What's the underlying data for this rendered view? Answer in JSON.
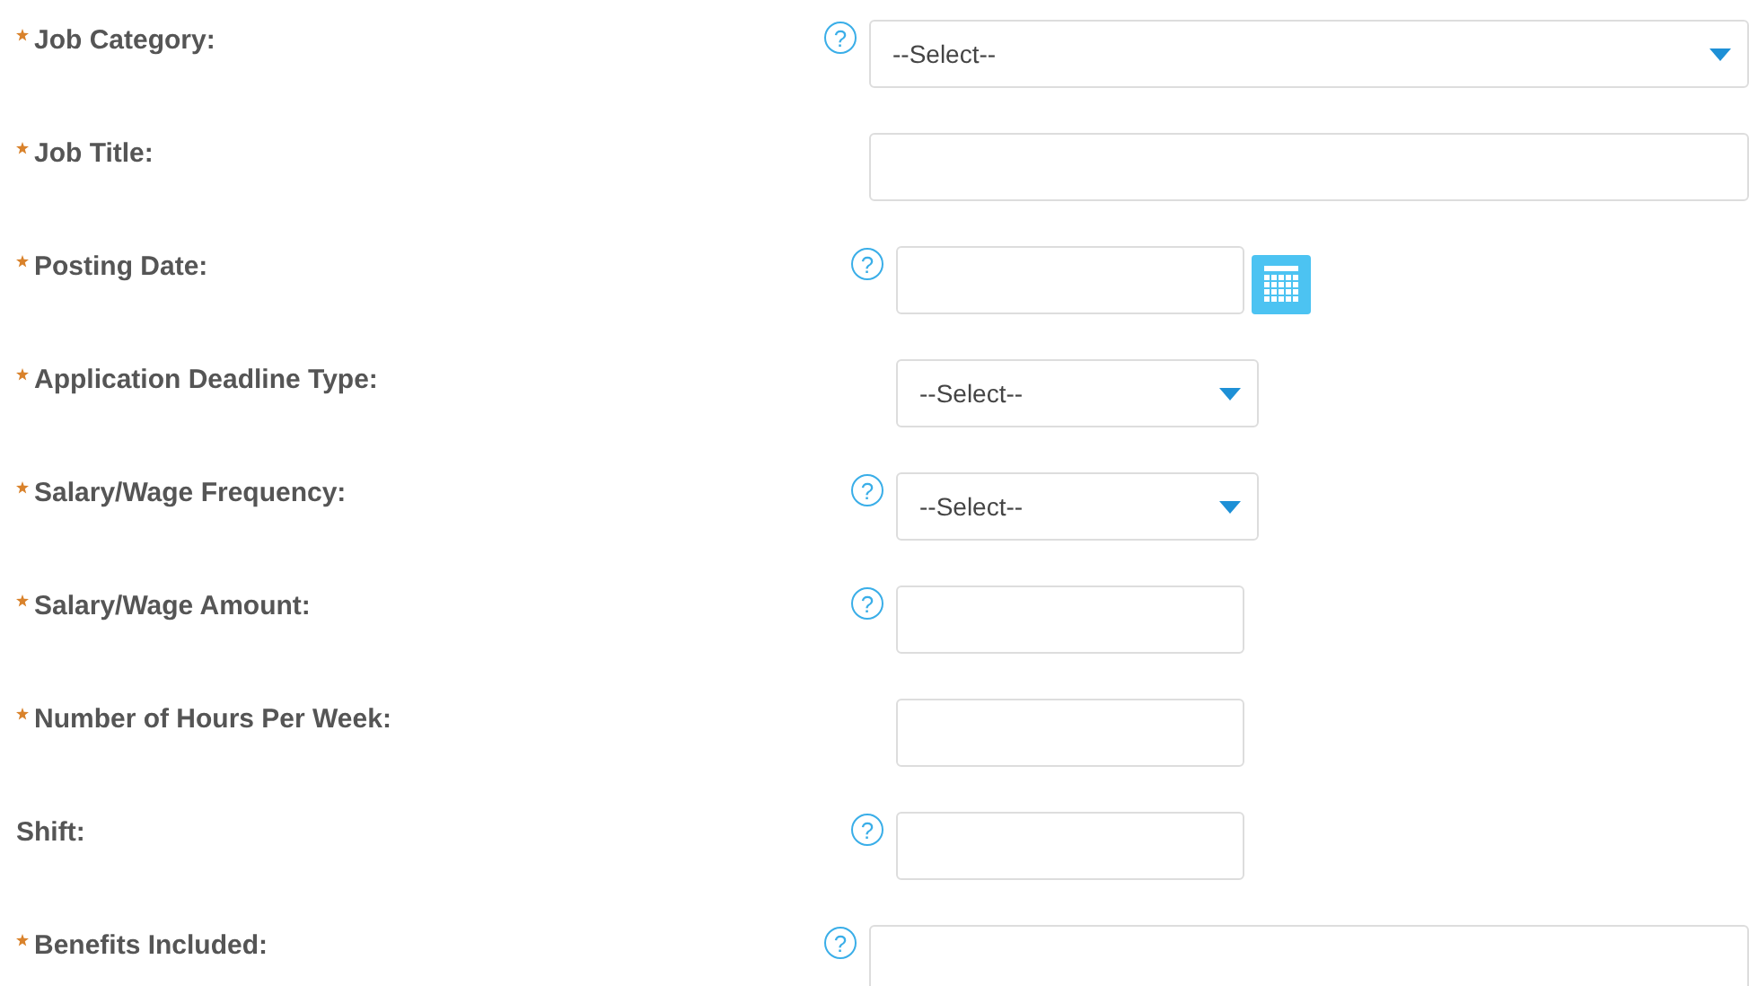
{
  "fields": [
    {
      "label": "Job Category:",
      "required": true,
      "help": "?",
      "kind": "select",
      "wide": true,
      "value": "--Select--"
    },
    {
      "label": "Job Title:",
      "required": true,
      "kind": "text",
      "wide": true
    },
    {
      "label": "Posting Date:",
      "required": true,
      "help": "?",
      "kind": "date",
      "wide": false
    },
    {
      "label": "Application Deadline Type:",
      "required": true,
      "kind": "select",
      "wide": false,
      "value": "--Select--"
    },
    {
      "label": "Salary/Wage Frequency:",
      "required": true,
      "help": "?",
      "kind": "select",
      "wide": false,
      "value": "--Select--"
    },
    {
      "label": "Salary/Wage Amount:",
      "required": true,
      "help": "?",
      "kind": "text",
      "wide": false
    },
    {
      "label": "Number of Hours Per Week:",
      "required": true,
      "kind": "text",
      "wide": false
    },
    {
      "label": "Shift:",
      "required": false,
      "help": "?",
      "kind": "text",
      "wide": false
    },
    {
      "label": "Benefits Included:",
      "required": true,
      "help": "?",
      "kind": "textarea",
      "wide": true
    }
  ]
}
